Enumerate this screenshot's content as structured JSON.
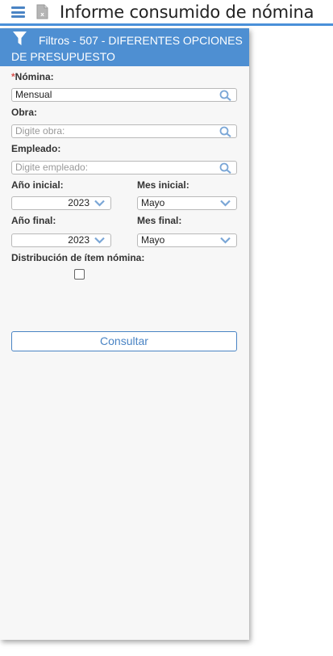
{
  "page": {
    "title": "Informe consumido de nómina"
  },
  "filters": {
    "header": "Filtros - 507 - DIFERENTES OPCIONES DE PRESUPUESTO",
    "nomina": {
      "required_mark": "*",
      "label": "Nómina:",
      "value": "Mensual"
    },
    "obra": {
      "label": "Obra:",
      "placeholder": "Digite obra:"
    },
    "empleado": {
      "label": "Empleado:",
      "placeholder": "Digite empleado:"
    },
    "anio_inicial": {
      "label": "Año inicial:",
      "value": "2023"
    },
    "mes_inicial": {
      "label": "Mes inicial:",
      "value": "Mayo"
    },
    "anio_final": {
      "label": "Año final:",
      "value": "2023"
    },
    "mes_final": {
      "label": "Mes final:",
      "value": "Mayo"
    },
    "distribucion": {
      "label": "Distribución de ítem nómina:",
      "checked": false
    },
    "submit_label": "Consultar"
  },
  "icons": {
    "menu": "hamburger-icon",
    "excel": "excel-file-icon",
    "filter": "filter-icon",
    "search": "search-icon",
    "dropdown": "chevron-down-icon"
  },
  "colors": {
    "accent": "#4e8fd2",
    "required": "#d9534f"
  }
}
